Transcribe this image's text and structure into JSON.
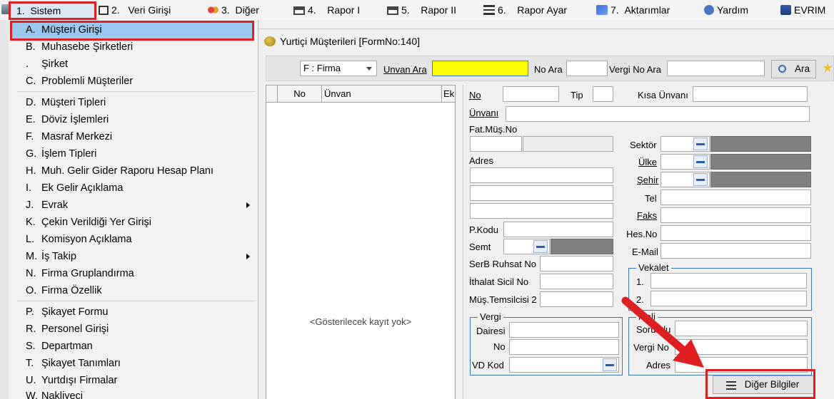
{
  "menubar": {
    "items": [
      {
        "key": "1.",
        "label": "Sistem"
      },
      {
        "key": "2.",
        "label": "Veri Girişi"
      },
      {
        "key": "3.",
        "label": "Diğer"
      },
      {
        "key": "4.",
        "label": "Rapor I"
      },
      {
        "key": "5.",
        "label": "Rapor II"
      },
      {
        "key": "6.",
        "label": "Rapor Ayar"
      },
      {
        "key": "7.",
        "label": "Aktarımlar"
      },
      {
        "key": "",
        "label": "Yardım"
      },
      {
        "key": "",
        "label": "EVRIM"
      }
    ]
  },
  "dropdown": {
    "items": [
      {
        "key": "A.",
        "label": "Müşteri Girişi"
      },
      {
        "key": "B.",
        "label": "Muhasebe Şirketleri"
      },
      {
        "key": ".",
        "label": "Şirket"
      },
      {
        "key": "C.",
        "label": "Problemli Müşteriler"
      },
      {
        "key": "D.",
        "label": "Müşteri Tipleri"
      },
      {
        "key": "E.",
        "label": "Döviz İşlemleri"
      },
      {
        "key": "F.",
        "label": "Masraf Merkezi"
      },
      {
        "key": "G.",
        "label": "İşlem Tipleri"
      },
      {
        "key": "H.",
        "label": "Muh. Gelir Gider Raporu Hesap Planı"
      },
      {
        "key": "I.",
        "label": "Ek Gelir Açıklama"
      },
      {
        "key": "J.",
        "label": "Evrak"
      },
      {
        "key": "K.",
        "label": "Çekin Verildiği Yer Girişi"
      },
      {
        "key": "L.",
        "label": "Komisyon Açıklama"
      },
      {
        "key": "M.",
        "label": "İş Takip"
      },
      {
        "key": "N.",
        "label": "Firma Gruplandırma"
      },
      {
        "key": "O.",
        "label": "Firma Özellik"
      },
      {
        "key": "P.",
        "label": "Şikayet Formu"
      },
      {
        "key": "R.",
        "label": "Personel Girişi"
      },
      {
        "key": "S.",
        "label": "Departman"
      },
      {
        "key": "T.",
        "label": "Şikayet Tanımları"
      },
      {
        "key": "U.",
        "label": "Yurtdışı Firmalar"
      },
      {
        "key": "W.",
        "label": "Nakliyeci"
      }
    ]
  },
  "form": {
    "title": "Yurtiçi Müşterileri [FormNo:140]",
    "search": {
      "type_select": "F : Firma",
      "unvan_ara_label": "Unvan Ara",
      "unvan_ara_value": "",
      "no_ara_label": "No Ara",
      "vergi_no_ara_label": "Vergi No Ara",
      "ara_button": "Ara"
    },
    "grid": {
      "columns": [
        "No",
        "Ünvan",
        "Ek"
      ],
      "empty_text": "<Gösterilecek kayıt yok>"
    },
    "detail": {
      "no": "No",
      "tip": "Tip",
      "kisa_unvani": "Kısa Ünvanı",
      "unvani": "Ünvanı",
      "fat_mus_no": "Fat.Müş.No",
      "sektor": "Sektör",
      "adres": "Adres",
      "ulke": "Ülke",
      "sehir": "Şehir",
      "tel": "Tel",
      "faks": "Faks",
      "p_kodu": "P.Kodu",
      "hes_no": "Hes.No",
      "semt": "Semt",
      "email": "E-Mail",
      "serb_ruhsat_no": "SerB Ruhsat No",
      "ithalat_sicil_no": "İthalat Sicil No",
      "mus_temsilcisi": "Müş.Temsilcisi 2",
      "vekalet": {
        "title": "Vekalet",
        "row1": "1.",
        "row2": "2."
      },
      "vergi": {
        "title": "Vergi",
        "dairesi": "Dairesi",
        "no": "No",
        "vd_kod": "VD Kod"
      },
      "mali": {
        "title": "Mali",
        "sorumlu": "Sorumlu",
        "vergi_no": "Vergi No",
        "adres": "Adres"
      },
      "diger_bilgiler": "Diğer Bilgiler"
    }
  },
  "colors": {
    "highlight_input": "#ffff00",
    "annotation_red": "#e02020",
    "menu_selected": "#99c9ef"
  }
}
